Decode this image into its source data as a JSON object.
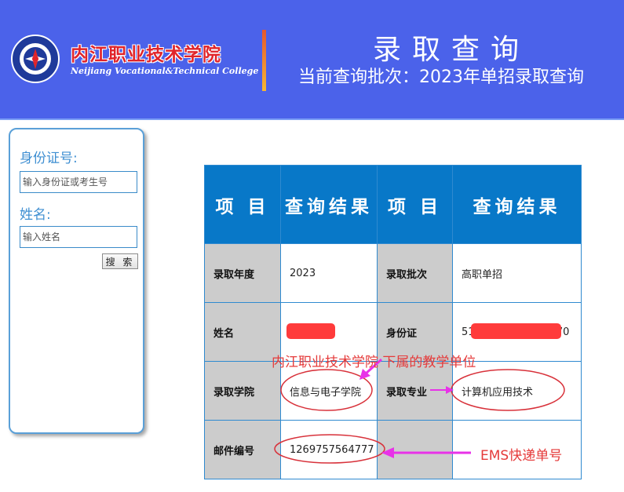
{
  "header": {
    "college_name_cn": "内江职业技术学院",
    "college_name_en": "Neijiang Vocational&Technical College",
    "title": "录取查询",
    "subtitle": "当前查询批次：2023年单招录取查询"
  },
  "search": {
    "id_label": "身份证号:",
    "id_placeholder": "输入身份证或考生号",
    "name_label": "姓名:",
    "name_placeholder": "输入姓名",
    "button_label": "搜 索"
  },
  "table": {
    "headers": [
      "项 目",
      "查询结果",
      "项 目",
      "查询结果"
    ],
    "rows": [
      {
        "label1": "录取年度",
        "value1": "2023",
        "label2": "录取批次",
        "value2": "高职单招"
      },
      {
        "label1": "姓名",
        "value1": "",
        "label2": "身份证",
        "value2_prefix": "51",
        "value2_suffix": "070"
      },
      {
        "label1": "录取学院",
        "value1": "信息与电子学院",
        "label2": "录取专业",
        "value2": "计算机应用技术"
      },
      {
        "label1": "邮件编号",
        "value1": "1269757564777",
        "label2": "",
        "value2": ""
      }
    ]
  },
  "annotations": {
    "college_note": "内江职业技术学院 下属的教学单位",
    "ems_note": "EMS快递单号",
    "color": "#e53a3a",
    "arrow_color": "#e832e8"
  },
  "colors": {
    "header_bg": "#4b62ea",
    "table_header_bg": "#0878c8",
    "label_cell_bg": "#cccccc",
    "redaction": "#ff3b3b"
  }
}
